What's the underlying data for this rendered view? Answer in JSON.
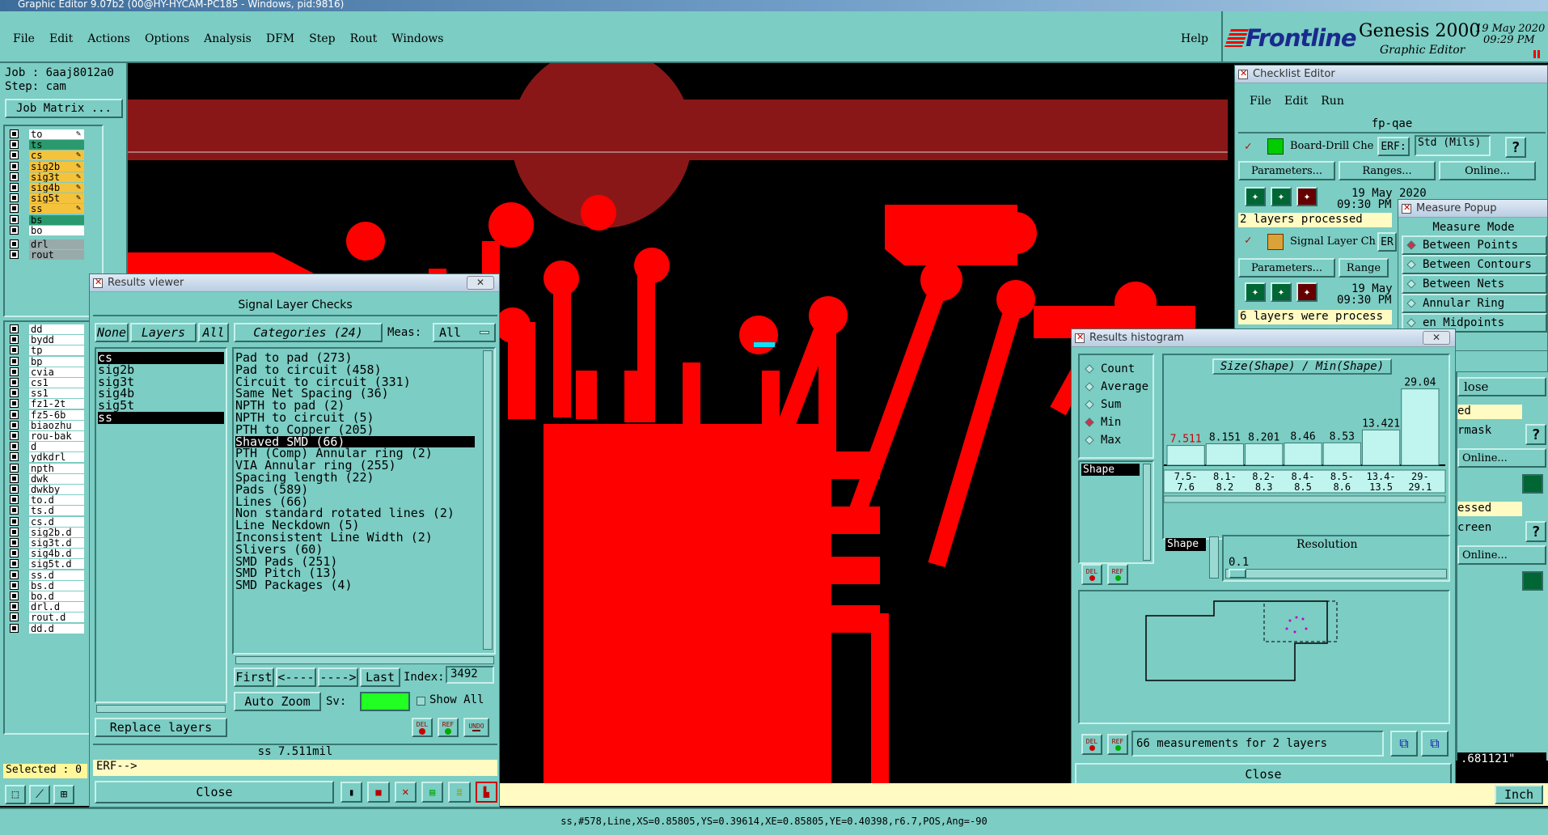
{
  "app": {
    "window_title": "Graphic Editor 9.07b2 (00@HY-HYCAM-PC185 - Windows, pid:9816)"
  },
  "menu": {
    "items": [
      "File",
      "Edit",
      "Actions",
      "Options",
      "Analysis",
      "DFM",
      "Step",
      "Rout",
      "Windows"
    ],
    "help": "Help"
  },
  "brand": {
    "logo": "Frontline",
    "product": "Genesis 2000",
    "subtitle": "Graphic Editor",
    "date": "19 May 2020",
    "time": "09:29 PM"
  },
  "job": {
    "job": "Job : 6aaj8012a0",
    "step": "Step: cam",
    "matrix_btn": "Job Matrix ...",
    "selected": "Selected : 0"
  },
  "layers": {
    "board": [
      "to",
      "ts",
      "cs",
      "sig2b",
      "sig3t",
      "sig4b",
      "sig5t",
      "ss",
      "bs",
      "bo"
    ],
    "drill": [
      "drl",
      "rout"
    ],
    "misc": [
      "dd",
      "bydd",
      "tp",
      "bp",
      "cvia",
      "cs1",
      "ss1",
      "fz1-2t",
      "fz5-6b",
      "biaozhu",
      "rou-bak",
      "d",
      "ydkdrl",
      "npth",
      "dwk",
      "dwkby",
      "to.d",
      "ts.d",
      "cs.d",
      "sig2b.d",
      "sig3t.d",
      "sig4b.d",
      "sig5t.d",
      "ss.d",
      "bs.d",
      "bo.d",
      "drl.d",
      "rout.d",
      "dd.d"
    ]
  },
  "results_viewer": {
    "title": "Results viewer",
    "header": "Signal Layer Checks",
    "btn_none": "None",
    "btn_layers": "Layers",
    "btn_all": "All",
    "categories_btn": "Categories (24)",
    "meas_label": "Meas:",
    "meas_value": "All",
    "layer_list": [
      "cs",
      "sig2b",
      "sig3t",
      "sig4b",
      "sig5t",
      "ss"
    ],
    "categories": [
      "Pad to pad (273)",
      "Pad to circuit (458)",
      "Circuit to circuit (331)",
      "Same Net Spacing (36)",
      "NPTH to pad (2)",
      "NPTH to circuit (5)",
      "PTH to Copper (205)",
      "Shaved SMD (66)",
      "PTH (Comp) Annular ring (2)",
      "VIA Annular ring (255)",
      "Spacing length (22)",
      "Pads (589)",
      "Lines (66)",
      "Non standard rotated lines (2)",
      "Line Neckdown (5)",
      "Inconsistent Line Width (2)",
      "Slivers (60)",
      "SMD Pads (251)",
      "SMD Pitch (13)",
      "SMD Packages (4)"
    ],
    "first": "First",
    "prev": "<----",
    "next": "---->",
    "last": "Last",
    "index_label": "Index:",
    "index_value": "3492",
    "auto_zoom": "Auto Zoom",
    "sv_label": "Sv:",
    "show_all": "Show All",
    "del": "DEL",
    "ref": "REF",
    "undo": "UNDO",
    "replace": "Replace layers",
    "status": "ss 7.511mil",
    "erf": "ERF-->",
    "close": "Close"
  },
  "checklist": {
    "title": "Checklist Editor",
    "menu": [
      "File",
      "Edit",
      "Run"
    ],
    "name": "fp-qae",
    "check1": {
      "name": "Board-Drill Che",
      "erf_label": "ERF:",
      "erf_value": "Std (Mils)",
      "date": "19 May 2020",
      "time": "09:30 PM",
      "status": "2 layers processed"
    },
    "check2": {
      "name": "Signal Layer Ch",
      "erf_label": "ER",
      "date": "19 May",
      "time": "09:30 PM",
      "status": "6 layers were process"
    },
    "params": "Parameters...",
    "ranges": "Ranges...",
    "online": "Online...",
    "ranges2": "Range",
    "partial": [
      "ed",
      "rmask",
      "Online...",
      "essed",
      "creen",
      "Online..."
    ],
    "close_partial": "lose",
    "help": "?"
  },
  "measure": {
    "title": "Measure Popup",
    "header": "Measure Mode",
    "options": [
      "Between Points",
      "Between Contours",
      "Between Nets",
      "Annular Ring",
      "en Midpoints"
    ],
    "coord": ".681121\""
  },
  "histogram": {
    "title": "Results histogram",
    "stats": [
      "Count",
      "Average",
      "Sum",
      "Min",
      "Max"
    ],
    "mode": "Shape",
    "header": "Size(Shape) / Min(Shape)",
    "resolution_label": "Resolution",
    "resolution_value": "0.1",
    "shape_tag": "Shape",
    "footer": "66 measurements for 2 layers",
    "close": "Close",
    "del": "DEL",
    "ref": "REF"
  },
  "chart_data": {
    "type": "bar",
    "title": "Size(Shape) / Min(Shape)",
    "categories": [
      "7.5-7.6",
      "8.1-8.2",
      "8.2-8.3",
      "8.4-8.5",
      "8.5-8.6",
      "13.4-13.5",
      "29-29.1"
    ],
    "values": [
      7.511,
      8.151,
      8.201,
      8.46,
      8.53,
      13.421,
      29.04
    ],
    "value_labels": [
      "7.511",
      "8.151",
      "8.201",
      "8.46",
      "8.53",
      "13.421",
      "29.04"
    ],
    "ylim": [
      0,
      32
    ]
  },
  "status_bar": {
    "text": "ss,#578,Line,XS=0.85805,YS=0.39614,XE=0.85805,YE=0.40398,r6.7,POS,Ang=-90",
    "units": "Inch"
  },
  "colors": {
    "panel": "#7ccdc4",
    "copper": "#ff0000",
    "dark_copper": "#8a1717",
    "highlight": "#00e5ff"
  }
}
